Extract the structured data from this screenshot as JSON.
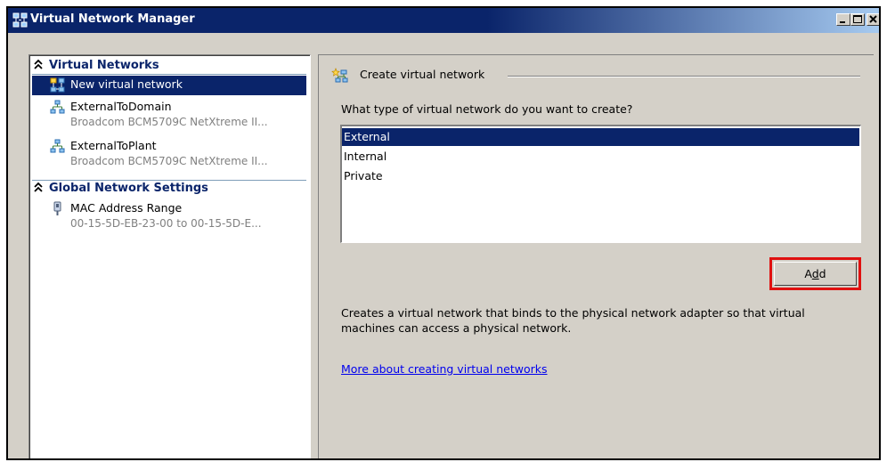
{
  "window": {
    "title": "Virtual Network Manager",
    "icon": "network-manager-icon"
  },
  "caption_buttons": [
    "minimize-icon",
    "maximize-icon",
    "close-icon"
  ],
  "sidebar": {
    "sections": [
      {
        "title": "Virtual Networks",
        "icon": "collapse-chevron-icon"
      },
      {
        "title": "Global Network Settings",
        "icon": "collapse-chevron-icon"
      }
    ],
    "items": [
      {
        "label": "New virtual network",
        "icon": "new-network-icon",
        "selected": true
      },
      {
        "label": "ExternalToDomain",
        "sub": "Broadcom BCM5709C NetXtreme II...",
        "icon": "network-icon"
      },
      {
        "label": "ExternalToPlant",
        "sub": "Broadcom BCM5709C NetXtreme II...",
        "icon": "network-icon"
      },
      {
        "label": "MAC Address Range",
        "sub": "00-15-5D-EB-23-00 to 00-15-5D-E...",
        "icon": "mac-address-icon"
      }
    ]
  },
  "main": {
    "group_title": "Create virtual network",
    "question": "What type of virtual network do you want to create?",
    "options": [
      "External",
      "Internal",
      "Private"
    ],
    "selected_option": "External",
    "add_label": "Add",
    "add_mnemonic": "d",
    "description": "Creates a virtual network that binds to the physical network adapter so that virtual machines can access a physical network.",
    "link_text": "More about creating virtual networks"
  },
  "colors": {
    "selection": "#0a246a",
    "highlight_outline": "#e01010",
    "link": "#0000ee",
    "face": "#d4d0c8"
  }
}
